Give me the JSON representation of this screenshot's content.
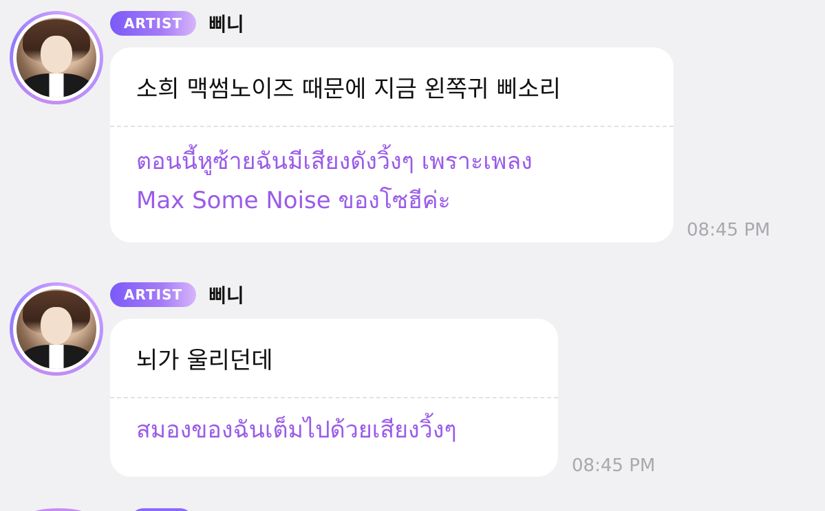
{
  "messages": [
    {
      "badge": "ARTIST",
      "sender": "삐니",
      "original": "소희 맥썸노이즈 때문에 지금 왼쪽귀 삐소리",
      "translation_line1": "ตอนนี้หูซ้ายฉันมีเสียงดังวิ้งๆ เพราะเพลง",
      "translation_line2": "Max Some Noise ของโซฮีค่ะ",
      "time": "08:45 PM"
    },
    {
      "badge": "ARTIST",
      "sender": "삐니",
      "original": "뇌가 울리던데",
      "translation_line1": "สมองของฉันเต็มไปด้วยเสียงวิ้งๆ",
      "time": "08:45 PM"
    }
  ],
  "colors": {
    "background": "#f1f1f3",
    "bubble": "#ffffff",
    "translation_text": "#9a5be8",
    "badge_start": "#7a5af8",
    "badge_end": "#d6b5fb",
    "timestamp": "#a8a8ad"
  }
}
